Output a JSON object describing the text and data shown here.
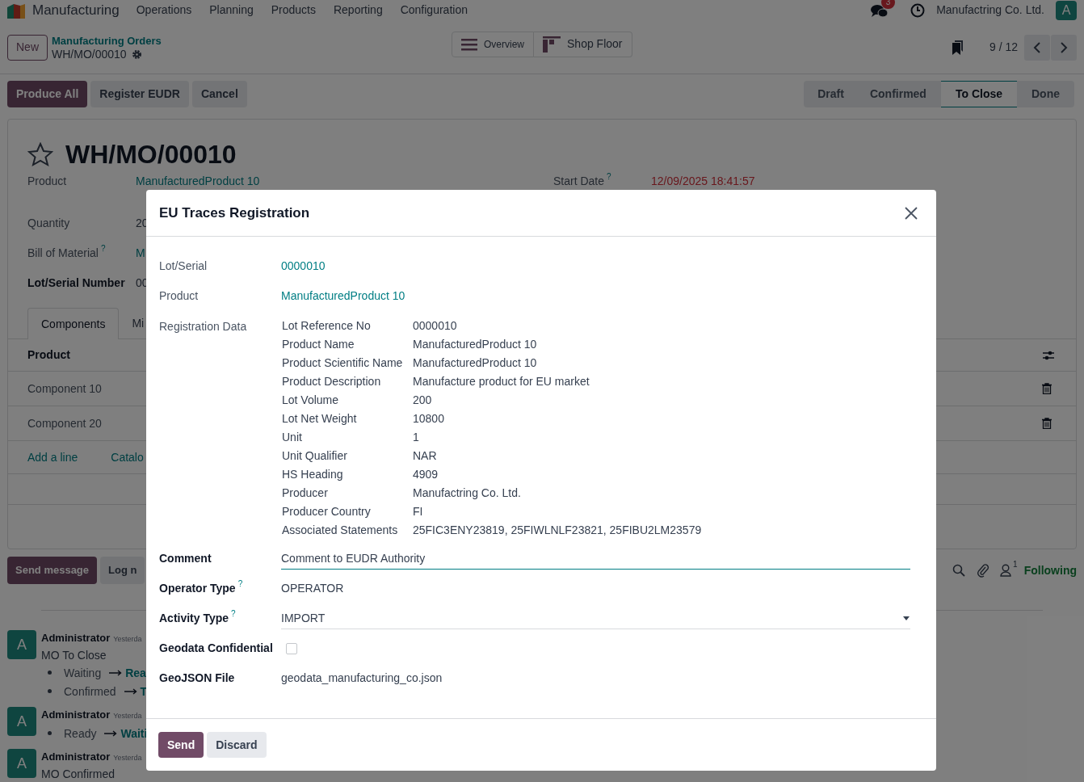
{
  "navbar": {
    "app": "Manufacturing",
    "menu": [
      "Operations",
      "Planning",
      "Products",
      "Reporting",
      "Configuration"
    ],
    "messages_count": "3",
    "company": "Manufactring Co. Ltd.",
    "avatar": "A"
  },
  "control_panel": {
    "new_button": "New",
    "breadcrumb": "Manufacturing Orders",
    "record": "WH/MO/00010",
    "views": [
      {
        "label": "Overview",
        "kind": "list"
      },
      {
        "label": "Shop Floor",
        "kind": "shopfloor"
      }
    ],
    "pager": "9 / 12"
  },
  "actions": [
    {
      "label": "Produce All",
      "primary": true
    },
    {
      "label": "Register EUDR",
      "primary": false
    },
    {
      "label": "Cancel",
      "primary": false
    }
  ],
  "stages": [
    {
      "label": "Draft",
      "selected": false
    },
    {
      "label": "Confirmed",
      "selected": false
    },
    {
      "label": "To Close",
      "selected": true
    },
    {
      "label": "Done",
      "selected": false
    }
  ],
  "form": {
    "starred": false,
    "title": "WH/MO/00010",
    "fields": [
      {
        "label": "Product",
        "value": "ManufacturedProduct 10",
        "bold": false,
        "link": true
      },
      {
        "label": "Quantity",
        "value": "20",
        "bold": false,
        "link": false
      },
      {
        "label": "Bill of Material",
        "help": "?",
        "value": "M",
        "bold": false,
        "link": true
      },
      {
        "label": "Lot/Serial Number",
        "value": "00",
        "bold": true,
        "link": false
      }
    ],
    "start_date": {
      "label": "Start Date",
      "help": "?",
      "value": "12/09/2025 18:41:57"
    },
    "tabs": [
      {
        "label": "Components",
        "selected": true
      },
      {
        "label": "Mi",
        "selected": false
      }
    ],
    "table": {
      "header": "Product",
      "rows": [
        "Component 10",
        "Component 20"
      ],
      "links": [
        "Add a line",
        "Catalo"
      ]
    }
  },
  "chatter": {
    "buttons": [
      {
        "label": "Send message",
        "primary": true
      },
      {
        "label": "Log n",
        "primary": false
      }
    ],
    "followers_count": "1",
    "follow": "Following",
    "messages": [
      {
        "avatar": "A",
        "author": "Administrator",
        "time": "Yesterda",
        "body": "MO To Close",
        "changes": [
          {
            "from": "Waiting",
            "to": "Rea"
          },
          {
            "from": "Confirmed",
            "to": "T"
          }
        ]
      },
      {
        "avatar": "A",
        "author": "Administrator",
        "time": "Yesterda",
        "changes": [
          {
            "from": "Ready",
            "to": "Waiti"
          }
        ]
      },
      {
        "avatar": "A",
        "author": "Administrator",
        "time": "Yesterda",
        "body": "MO Confirmed"
      }
    ]
  },
  "dialog": {
    "title": "EU Traces Registration",
    "fields": [
      {
        "kind": "link",
        "label": "Lot/Serial",
        "value": "0000010",
        "bold": false
      },
      {
        "kind": "link",
        "label": "Product",
        "value": "ManufacturedProduct 10",
        "bold": false
      },
      {
        "kind": "table",
        "label": "Registration Data",
        "bold": false,
        "rows": [
          {
            "key": "Lot Reference No",
            "value": "0000010"
          },
          {
            "key": "Product Name",
            "value": "ManufacturedProduct 10"
          },
          {
            "key": "Product Scientific Name",
            "value": "ManufacturedProduct 10"
          },
          {
            "key": "Product Description",
            "value": "Manufacture product for EU market"
          },
          {
            "key": "Lot Volume",
            "value": "200"
          },
          {
            "key": "Lot Net Weight",
            "value": "10800"
          },
          {
            "key": "Unit",
            "value": "1"
          },
          {
            "key": "Unit Qualifier",
            "value": "NAR"
          },
          {
            "key": "HS Heading",
            "value": "4909"
          },
          {
            "key": "Producer",
            "value": "Manufactring Co. Ltd."
          },
          {
            "key": "Producer Country",
            "value": "FI"
          },
          {
            "key": "Associated Statements",
            "value": "25FIC3ENY23819, 25FIWLNLF23821, 25FIBU2LM23579"
          }
        ]
      },
      {
        "kind": "input",
        "label": "Comment",
        "value": "Comment to EUDR Authority",
        "bold": true
      },
      {
        "kind": "text",
        "label": "Operator Type",
        "help": "?",
        "value": "OPERATOR",
        "bold": true
      },
      {
        "kind": "select",
        "label": "Activity Type",
        "help": "?",
        "value": "IMPORT",
        "bold": true
      },
      {
        "kind": "checkbox",
        "label": "Geodata Confidential",
        "checked": false,
        "bold": true
      },
      {
        "kind": "text",
        "label": "GeoJSON File",
        "value": "geodata_manufacturing_co.json",
        "bold": true
      }
    ],
    "buttons": [
      {
        "label": "Send",
        "primary": true
      },
      {
        "label": "Discard",
        "primary": false
      }
    ]
  }
}
